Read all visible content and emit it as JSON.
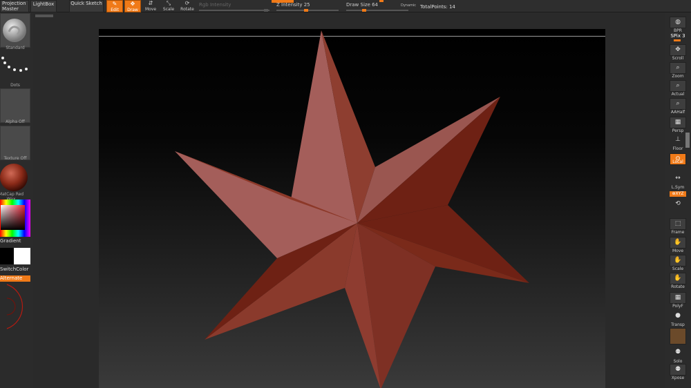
{
  "top_bar": {
    "projection_master": "Projection Master",
    "lightbox": "LightBox",
    "quick_sketch": "Quick Sketch",
    "tools": [
      {
        "label": "Edit",
        "glyph": "✎",
        "active": true
      },
      {
        "label": "Draw",
        "glyph": "✥",
        "active": true
      },
      {
        "label": "Move",
        "glyph": "⇵",
        "active": false
      },
      {
        "label": "Scale",
        "glyph": "⤡",
        "active": false
      },
      {
        "label": "Rotate",
        "glyph": "⟳",
        "active": false
      }
    ],
    "rgb_intensity": "Rgb Intensity",
    "z_intensity": "Z Intensity 25",
    "draw_size": "Draw Size 64",
    "dynamic": "Dynamic",
    "total_points": "TotalPoints: 14"
  },
  "left_shelf": {
    "brush": "Standard",
    "stroke": "Dots",
    "alpha": "Alpha Off",
    "texture": "Texture Off",
    "material": "MatCap Red Wax",
    "gradient": "Gradient",
    "switch_color": "SwitchColor",
    "alternate": "Alternate"
  },
  "right_shelf": {
    "bpr": "BPR",
    "spix": "SPix 3",
    "scroll": "Scroll",
    "zoom": "Zoom",
    "actual": "Actual",
    "aahalf": "AAHalf",
    "persp": "Persp",
    "floor": "Floor",
    "local": "Local",
    "lsym": "L.Sym",
    "xyz": "⊕XYZ",
    "frame": "Frame",
    "move": "Move",
    "scale": "Scale",
    "rotate": "Rotate",
    "polyf": "PolyF",
    "transp": "Transp",
    "solo": "Solo",
    "xpose": "Xpose"
  },
  "colors": {
    "accent": "#f07a18",
    "star_light": "#a45e5a",
    "star_dark": "#6e2114"
  }
}
